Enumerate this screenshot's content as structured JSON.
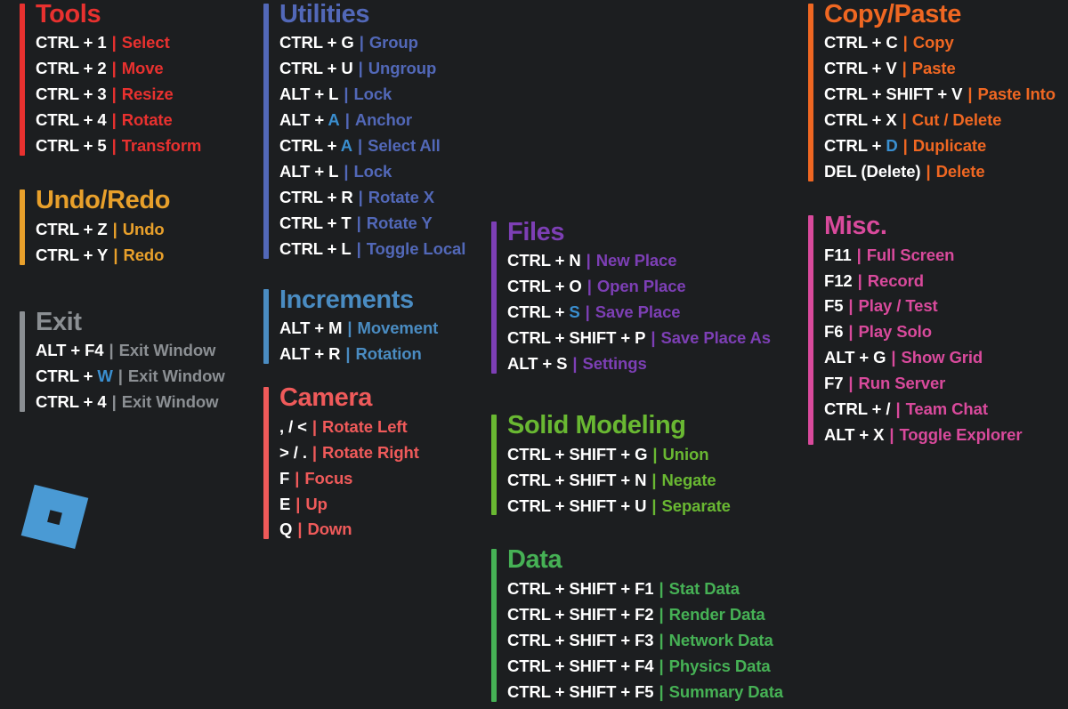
{
  "meta": {
    "background": "#1c1e20",
    "key_color": "#ffffff",
    "highlight_color": "#3a8fd0",
    "logo_color": "#4a9ad4",
    "logo_name": "roblox-logo"
  },
  "columns": [
    {
      "id": "column-1",
      "sections": [
        {
          "id": "tools",
          "title": "Tools",
          "accent": "#e8312f",
          "rows": [
            {
              "combo": "CTRL + 1",
              "desc": "Select"
            },
            {
              "combo": "CTRL + 2",
              "desc": "Move"
            },
            {
              "combo": "CTRL + 3",
              "desc": "Resize"
            },
            {
              "combo": "CTRL + 4",
              "desc": "Rotate"
            },
            {
              "combo": "CTRL + 5",
              "desc": "Transform"
            }
          ]
        },
        {
          "id": "undo-redo",
          "title": "Undo/Redo",
          "accent": "#e8a02b",
          "rows": [
            {
              "combo": "CTRL + Z",
              "desc": "Undo"
            },
            {
              "combo": "CTRL + Y",
              "desc": "Redo"
            }
          ]
        },
        {
          "id": "exit",
          "title": "Exit",
          "accent": "#8b8f93",
          "rows": [
            {
              "combo": "ALT + F4",
              "desc": "Exit Window"
            },
            {
              "combo": "CTRL + ",
              "combo_highlight": "W",
              "desc": "Exit Window"
            },
            {
              "combo": "CTRL + 4",
              "desc": "Exit Window"
            }
          ]
        }
      ]
    },
    {
      "id": "column-2",
      "sections": [
        {
          "id": "utilities",
          "title": "Utilities",
          "accent": "#5268b8",
          "rows": [
            {
              "combo": "CTRL + G",
              "desc": "Group"
            },
            {
              "combo": "CTRL + U",
              "desc": "Ungroup"
            },
            {
              "combo": "ALT + L",
              "desc": "Lock"
            },
            {
              "combo": "ALT + ",
              "combo_highlight": "A",
              "desc": "Anchor"
            },
            {
              "combo": "CTRL + ",
              "combo_highlight": "A",
              "desc": "Select All"
            },
            {
              "combo": "ALT + L",
              "desc": "Lock"
            },
            {
              "combo": "CTRL + R",
              "desc": "Rotate X"
            },
            {
              "combo": "CTRL + T",
              "desc": "Rotate Y"
            },
            {
              "combo": "CTRL + L",
              "desc": "Toggle Local"
            }
          ]
        },
        {
          "id": "increments",
          "title": "Increments",
          "accent": "#4a8cc2",
          "rows": [
            {
              "combo": "ALT + M",
              "desc": "Movement"
            },
            {
              "combo": "ALT + R",
              "desc": "Rotation"
            }
          ]
        },
        {
          "id": "camera",
          "title": "Camera",
          "accent": "#ef5a5a",
          "rows": [
            {
              "combo": ", / <",
              "desc": "Rotate Left"
            },
            {
              "combo": "> / .",
              "desc": "Rotate Right"
            },
            {
              "combo": "F",
              "desc": "Focus"
            },
            {
              "combo": "E",
              "desc": "Up"
            },
            {
              "combo": "Q",
              "desc": "Down"
            }
          ]
        }
      ]
    },
    {
      "id": "column-3",
      "sections": [
        {
          "id": "files",
          "title": "Files",
          "accent": "#7d3fb5",
          "rows": [
            {
              "combo": "CTRL + N",
              "desc": "New Place"
            },
            {
              "combo": "CTRL + O",
              "desc": "Open Place"
            },
            {
              "combo": "CTRL + ",
              "combo_highlight": "S",
              "desc": "Save Place"
            },
            {
              "combo": "CTRL + SHIFT + P",
              "desc": "Save Place As"
            },
            {
              "combo": "ALT + S",
              "desc": "Settings"
            }
          ]
        },
        {
          "id": "solid-modeling",
          "title": "Solid Modeling",
          "accent": "#69b832",
          "rows": [
            {
              "combo": "CTRL + SHIFT + G",
              "desc": "Union"
            },
            {
              "combo": "CTRL + SHIFT + N",
              "desc": "Negate"
            },
            {
              "combo": "CTRL + SHIFT + U",
              "desc": "Separate"
            }
          ]
        },
        {
          "id": "data",
          "title": "Data",
          "accent": "#46b155",
          "rows": [
            {
              "combo": "CTRL + SHIFT + F1",
              "desc": "Stat Data"
            },
            {
              "combo": "CTRL + SHIFT + F2",
              "desc": "Render Data"
            },
            {
              "combo": "CTRL + SHIFT + F3",
              "desc": "Network Data"
            },
            {
              "combo": "CTRL + SHIFT + F4",
              "desc": "Physics Data"
            },
            {
              "combo": "CTRL + SHIFT + F5",
              "desc": "Summary Data"
            }
          ]
        }
      ]
    },
    {
      "id": "column-4",
      "sections": [
        {
          "id": "copy-paste",
          "title": "Copy/Paste",
          "accent": "#ef6722",
          "rows": [
            {
              "combo": "CTRL + C",
              "desc": "Copy"
            },
            {
              "combo": "CTRL + V",
              "desc": "Paste"
            },
            {
              "combo": "CTRL + SHIFT + V",
              "desc": "Paste Into"
            },
            {
              "combo": "CTRL + X",
              "desc": "Cut / Delete"
            },
            {
              "combo": "CTRL + ",
              "combo_highlight": "D",
              "desc": "Duplicate"
            },
            {
              "combo": "DEL (Delete)",
              "desc": "Delete"
            }
          ]
        },
        {
          "id": "misc",
          "title": "Misc.",
          "accent": "#d94a9c",
          "rows": [
            {
              "combo": "F11",
              "desc": "Full Screen"
            },
            {
              "combo": "F12",
              "desc": "Record"
            },
            {
              "combo": "F5",
              "desc": "Play / Test"
            },
            {
              "combo": "F6",
              "desc": "Play Solo"
            },
            {
              "combo": "ALT + G",
              "desc": "Show Grid"
            },
            {
              "combo": "F7",
              "desc": "Run Server"
            },
            {
              "combo": "CTRL + /",
              "desc": "Team Chat"
            },
            {
              "combo": "ALT + X",
              "desc": "Toggle Explorer"
            }
          ]
        }
      ]
    }
  ],
  "layout": {
    "column_offsets": [
      0,
      0,
      245,
      0
    ],
    "section_gaps": {
      "column-1": [
        26,
        40
      ],
      "column-2": [
        22,
        14
      ],
      "column-3": [
        34,
        26
      ],
      "column-4": [
        26
      ]
    }
  }
}
